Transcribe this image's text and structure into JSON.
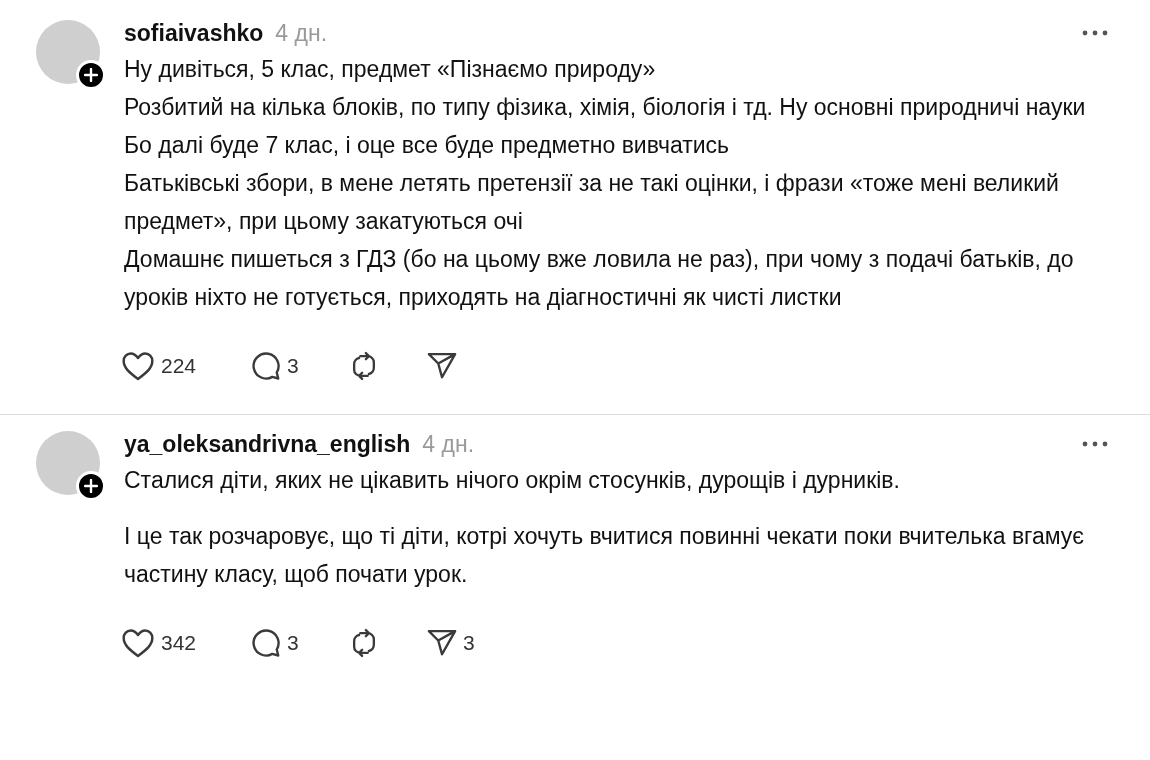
{
  "posts": [
    {
      "username": "sofiaivashko",
      "time": "4 дн.",
      "paragraphs": [
        "Ну дивіться, 5 клас, предмет «Пізнаємо природу»\nРозбитий на кілька блоків, по типу фізика, хімія, біологія і тд. Ну основні природничі науки\nБо далі буде 7 клас, і оце все буде предметно вивчатись\nБатьківські збори, в мене летять претензії за не такі оцінки, і фрази «тоже мені великий предмет», при цьому закатуються очі\nДомашнє пишеться з ГДЗ (бо на цьому вже ловила не раз), при чому з подачі батьків, до уроків ніхто не готується, приходять на діагностичні як чисті листки"
      ],
      "likes": "224",
      "replies": "3"
    },
    {
      "username": "ya_oleksandrivna_english",
      "time": "4 дн.",
      "paragraphs": [
        "Сталися діти, яких не цікавить нічого окрім стосунків, дурощів і дурників.",
        "І це так розчаровує, що ті діти, котрі хочуть вчитися повинні чекати поки вчителька вгамує частину класу, щоб почати урок."
      ],
      "likes": "342",
      "replies": "3",
      "shares": "3"
    }
  ]
}
